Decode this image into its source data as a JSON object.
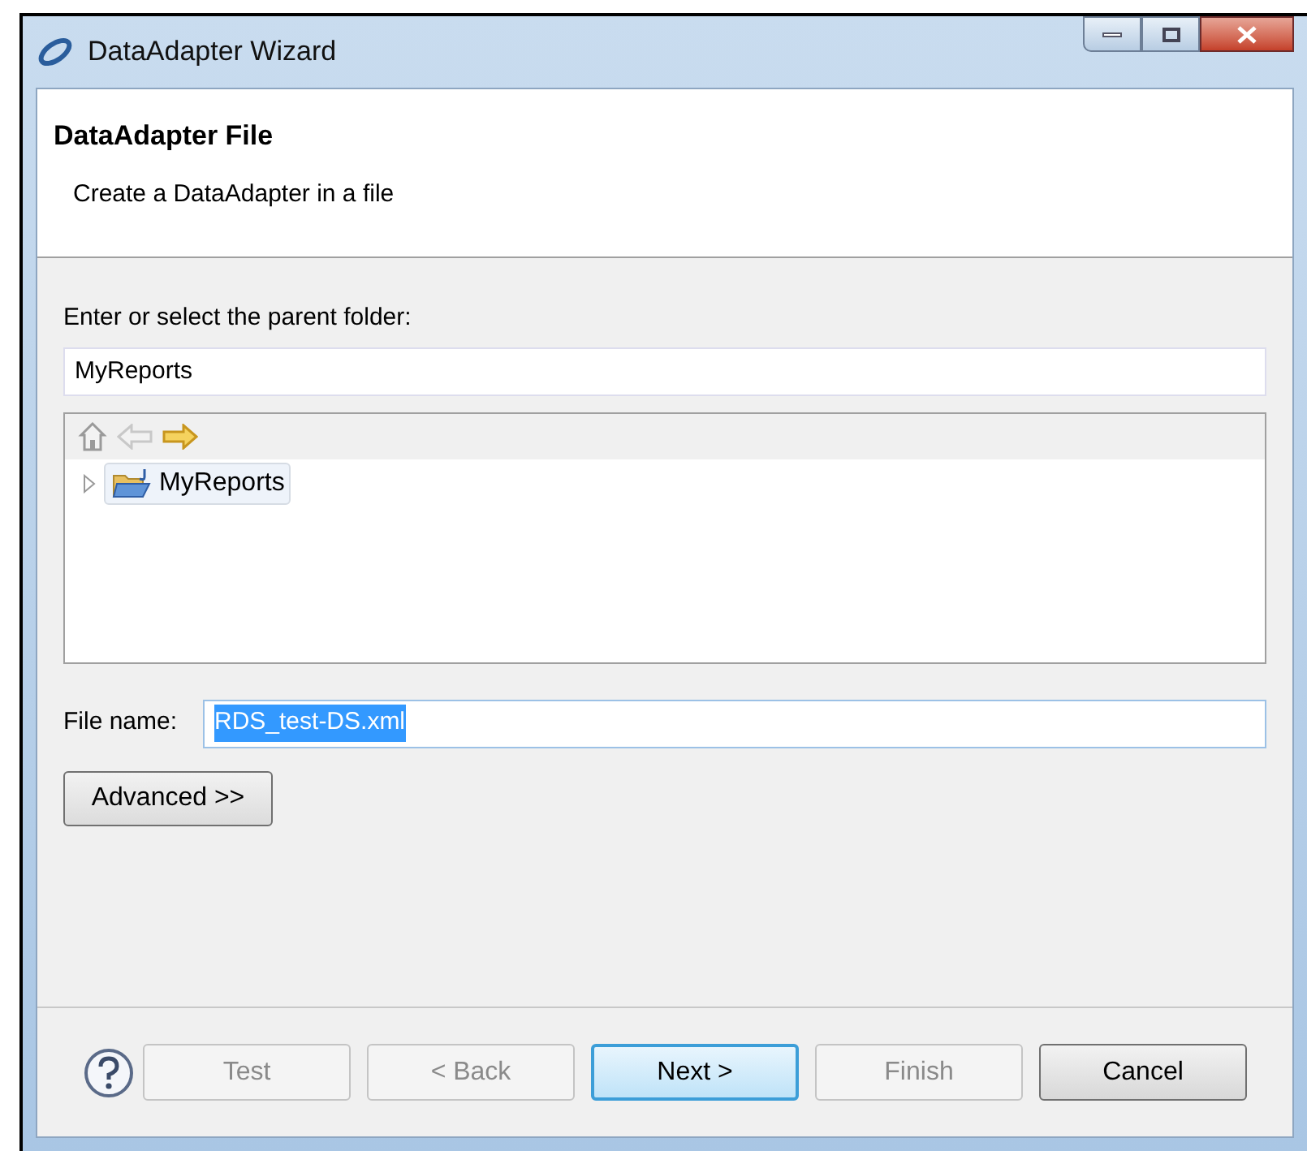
{
  "window": {
    "title": "DataAdapter Wizard"
  },
  "header": {
    "title": "DataAdapter File",
    "subtitle": "Create a DataAdapter in a file"
  },
  "folder": {
    "label": "Enter or select the parent folder:",
    "value": "MyReports"
  },
  "tree": {
    "items": [
      {
        "label": "MyReports",
        "selected": true,
        "expanded": false
      }
    ]
  },
  "file_name": {
    "label": "File name:",
    "value": "RDS_test-DS.xml",
    "text_selected": true
  },
  "advanced_button": {
    "label": "Advanced >>"
  },
  "buttons": [
    {
      "label": "Test",
      "disabled": true,
      "default": false
    },
    {
      "label": "< Back",
      "disabled": true,
      "default": false
    },
    {
      "label": "Next >",
      "disabled": false,
      "default": true
    },
    {
      "label": "Finish",
      "disabled": true,
      "default": false
    },
    {
      "label": "Cancel",
      "disabled": false,
      "default": false
    }
  ]
}
